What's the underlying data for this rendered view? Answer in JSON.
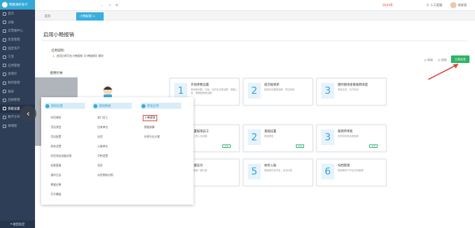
{
  "sidebar": {
    "brand": "畅捷通好会计",
    "items": [
      {
        "label": "首页",
        "active": false
      },
      {
        "label": "总账",
        "active": false
      },
      {
        "label": "云票据中心",
        "active": false
      },
      {
        "label": "资金管理",
        "active": false
      },
      {
        "label": "固定资产",
        "active": false
      },
      {
        "label": "工资",
        "active": false
      },
      {
        "label": "应用管理",
        "active": false
      },
      {
        "label": "进销存",
        "active": false
      },
      {
        "label": "税务管理",
        "active": false
      },
      {
        "label": "报表",
        "active": false
      },
      {
        "label": "出纳管理",
        "active": false
      },
      {
        "label": "基础设置",
        "active": true
      },
      {
        "label": "数字引导",
        "active": false
      },
      {
        "label": "离线版",
        "active": false
      }
    ],
    "footer": "收回组定"
  },
  "topbar": {
    "period": "2020年",
    "help": "人工客服",
    "user": "杨某某"
  },
  "tabs": {
    "home": "首页",
    "active": "小畅报销 ×"
  },
  "page": {
    "title": "启用小畅报销",
    "section_a": "启用说明:",
    "section_a_text": "启用后将可在小畅报销【小畅报销】模块",
    "help_link": "帮助",
    "video_link": "视频",
    "enable_button": "立即启用",
    "section_b": "使用引导"
  },
  "cards": [
    {
      "num": "1",
      "title": "外观参数设置",
      "desc": "报销单标题、字段、控件标注等设置，单据上传、票据配置等设置",
      "tag": ""
    },
    {
      "num": "2",
      "title": "提交报销单",
      "desc": "报销员创建报销单，提交审批",
      "tag": ""
    },
    {
      "num": "3",
      "title": "随时随地查看报销进度",
      "desc": "审批状态，支付状态",
      "tag": ""
    },
    {
      "num": "4",
      "title": "设置报销员工",
      "desc": "员工导入及创建",
      "tag": "设置"
    },
    {
      "num": "2",
      "title": "基础设置",
      "desc": "报销类型",
      "tag": "设置"
    },
    {
      "num": "3",
      "title": "报销单审批",
      "desc": "在财务审核及报销单",
      "tag": "设置"
    },
    {
      "num": "4",
      "title": "一键支付",
      "desc": "报销单一键付款",
      "tag": ""
    },
    {
      "num": "5",
      "title": "财务入账",
      "desc": "报销单生成凭证，自动记账",
      "tag": ""
    },
    {
      "num": "6",
      "title": "归档管理",
      "desc": "报销单电子凭证归档管理",
      "tag": ""
    }
  ],
  "popup": {
    "col1_head": "基础设置",
    "col2_head": "基础数据",
    "col3_head": "增值应用",
    "col1": [
      "科目期初",
      "凭证类型",
      "凭证配置",
      "财务设置",
      "科目现金流量对照",
      "权限管理",
      "操作日志",
      "数据迁移",
      "打印模板"
    ],
    "col2": [
      "部门员工",
      "往来单位",
      "存货",
      "计量单位",
      "币种设置",
      "项目",
      "存货税收对照"
    ],
    "col3": [
      "小畅报销",
      "票据核算",
      "外贸行业方案"
    ],
    "selected": "小畅报销"
  },
  "colors": {
    "sidebar": "#2e3e56",
    "accent": "#3aaede",
    "enable_button": "#2fb467",
    "arrow": "#e0453a"
  }
}
